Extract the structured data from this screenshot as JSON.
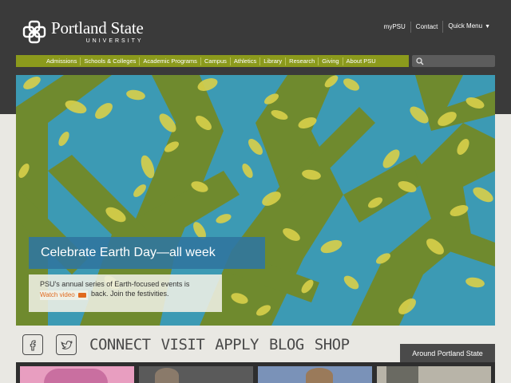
{
  "brand": {
    "name": "Portland State",
    "sub": "UNIVERSITY"
  },
  "utility": {
    "mypsu": "myPSU",
    "contact": "Contact",
    "quick_menu": "Quick Menu"
  },
  "nav": {
    "items": [
      "Admissions",
      "Schools & Colleges",
      "Academic Programs",
      "Campus",
      "Athletics",
      "Library",
      "Research",
      "Giving",
      "About PSU"
    ]
  },
  "search": {
    "placeholder": ""
  },
  "hero": {
    "title": "Celebrate Earth Day—all week",
    "description_1": "PSU's annual series of Earth-focused events is",
    "description_2": "back. Join the festivities.",
    "watch_video": "Watch video"
  },
  "cta": {
    "connect": "CONNECT",
    "visit": "VISIT",
    "apply": "APPLY",
    "blog": "BLOG",
    "shop": "SHOP"
  },
  "around": {
    "label": "Around Portland State"
  },
  "colors": {
    "header_bg": "#3a3a3a",
    "nav_olive": "#8b9a1c",
    "hero_blue": "#3c9ab4",
    "hero_green": "#6f8a2e",
    "leaf_yellow": "#d9d04a",
    "link_orange": "#e06a1f"
  },
  "icons": {
    "logo": "psu-knot-logo-icon",
    "search": "search-icon",
    "facebook": "facebook-icon",
    "twitter": "twitter-icon",
    "camera": "video-camera-icon"
  }
}
